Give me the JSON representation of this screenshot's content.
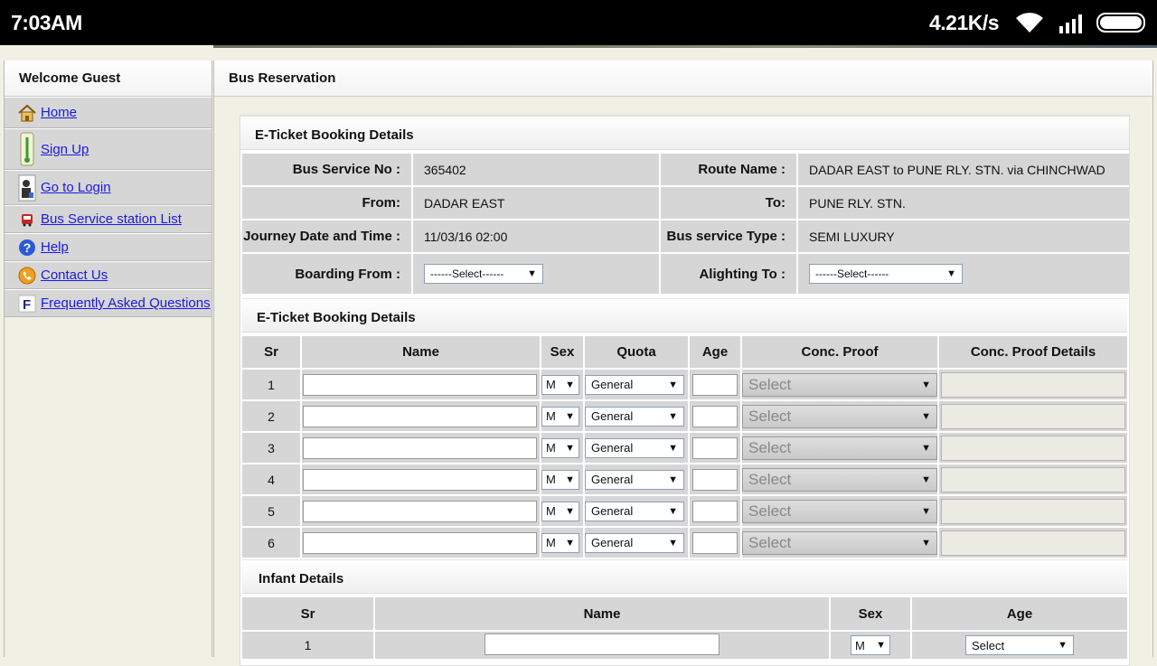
{
  "status": {
    "time": "7:03AM",
    "rate": "4.21K/s"
  },
  "sidebar": {
    "welcome": "Welcome Guest",
    "items": [
      {
        "label": "Home",
        "icon": "home-icon"
      },
      {
        "label": "Sign Up",
        "icon": "signup-icon"
      },
      {
        "label": "Go to Login",
        "icon": "login-icon"
      },
      {
        "label": "Bus Service station List",
        "icon": "bus-icon"
      },
      {
        "label": "Help",
        "icon": "help-icon"
      },
      {
        "label": "Contact Us",
        "icon": "phone-icon"
      },
      {
        "label": "Frequently Asked Questions",
        "icon": "faq-icon"
      }
    ]
  },
  "main": {
    "title": "Bus Reservation",
    "booking_section": "E-Ticket Booking Details",
    "details": {
      "bus_service_label": "Bus Service No :",
      "bus_service_value": "365402",
      "route_label": "Route Name :",
      "route_value": "DADAR EAST to PUNE RLY. STN. via CHINCHWAD",
      "from_label": "From:",
      "from_value": "DADAR EAST",
      "to_label": "To:",
      "to_value": "PUNE RLY. STN.",
      "journey_label": "Journey Date and Time :",
      "journey_value": "11/03/16 02:00",
      "type_label": "Bus service Type :",
      "type_value": "SEMI LUXURY",
      "boarding_label": "Boarding From :",
      "boarding_value": "------Select------",
      "alighting_label": "Alighting To :",
      "alighting_value": "------Select------"
    },
    "passenger_section": "E-Ticket Booking Details",
    "passenger_headers": [
      "Sr",
      "Name",
      "Sex",
      "Quota",
      "Age",
      "Conc. Proof",
      "Conc. Proof Details"
    ],
    "passengers": [
      {
        "sr": "1",
        "sex": "M",
        "quota": "General",
        "proof": "Select"
      },
      {
        "sr": "2",
        "sex": "M",
        "quota": "General",
        "proof": "Select"
      },
      {
        "sr": "3",
        "sex": "M",
        "quota": "General",
        "proof": "Select"
      },
      {
        "sr": "4",
        "sex": "M",
        "quota": "General",
        "proof": "Select"
      },
      {
        "sr": "5",
        "sex": "M",
        "quota": "General",
        "proof": "Select"
      },
      {
        "sr": "6",
        "sex": "M",
        "quota": "General",
        "proof": "Select"
      }
    ],
    "infant_section": "Infant Details",
    "infant_headers": [
      "Sr",
      "Name",
      "Sex",
      "Age"
    ],
    "infants": [
      {
        "sr": "1",
        "sex": "M",
        "age": "Select"
      }
    ]
  }
}
